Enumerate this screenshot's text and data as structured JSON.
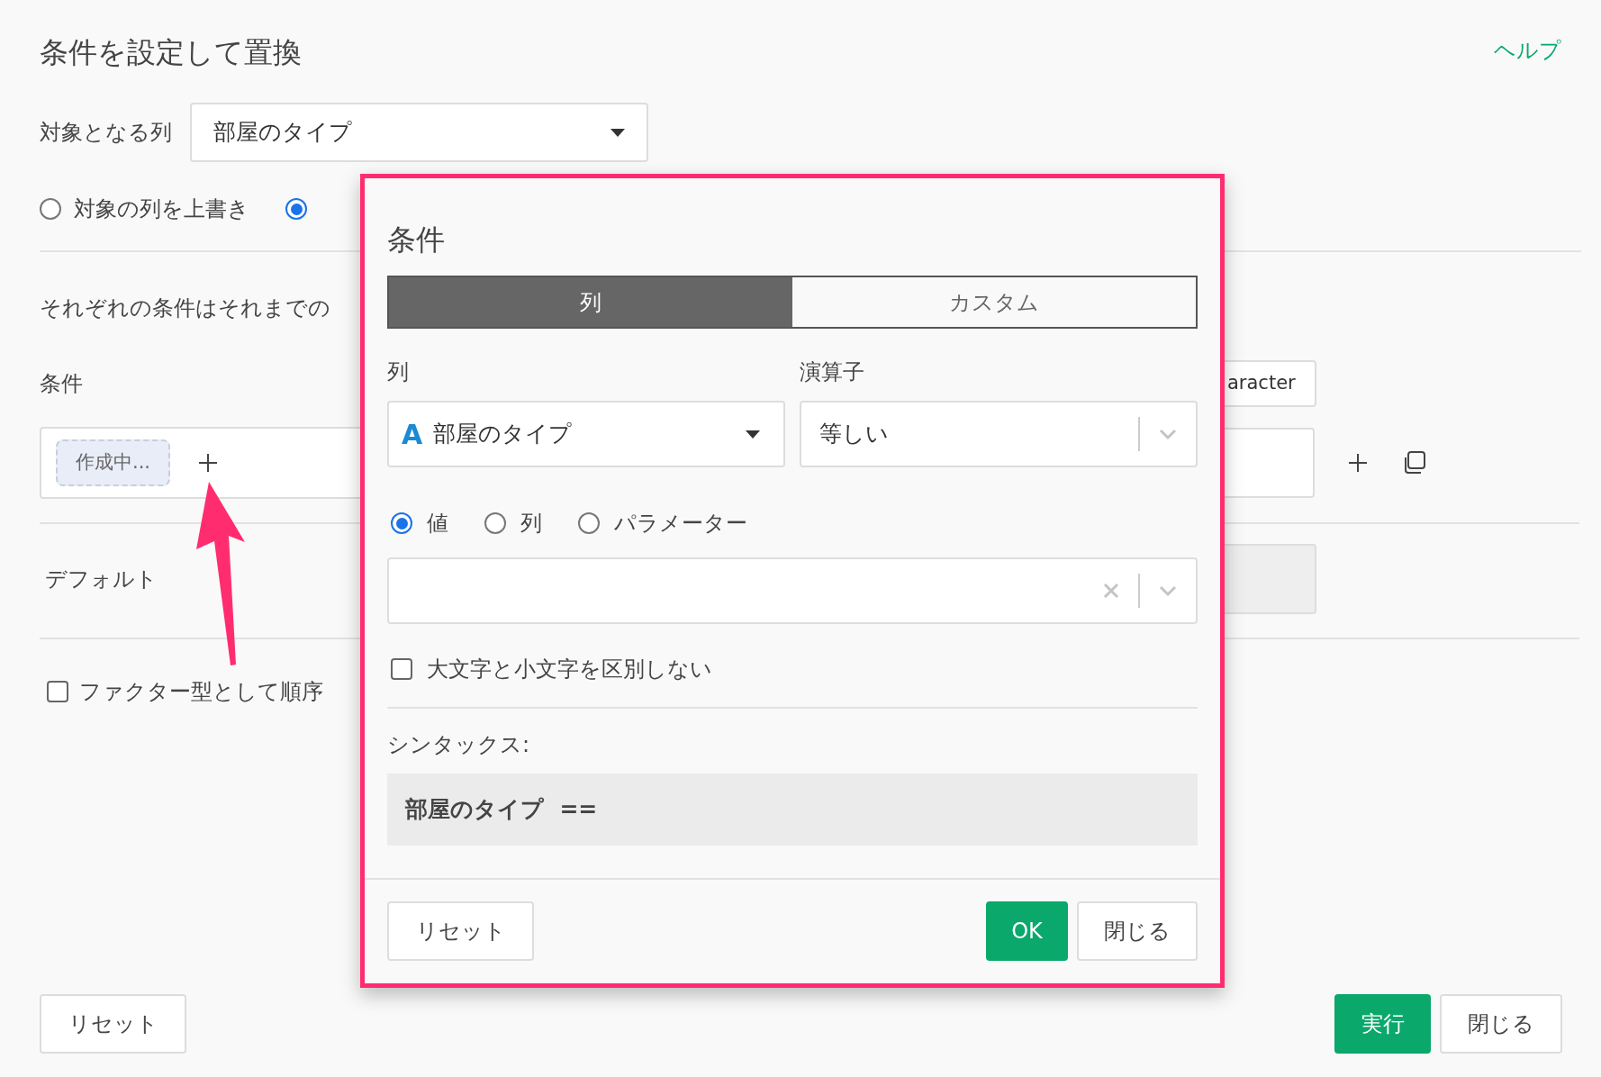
{
  "title": "条件を設定して置換",
  "help_link": "ヘルプ",
  "target_column": {
    "label": "対象となる列",
    "value": "部屋のタイプ"
  },
  "output_options": [
    {
      "label": "対象の列を上書き",
      "selected": false
    },
    {
      "selected": true
    }
  ],
  "description": "それぞれの条件はそれまでの",
  "conditions": {
    "label": "条件",
    "chip": "作成中...",
    "type_select": "aracter"
  },
  "default": {
    "label": "デフォルト"
  },
  "factor_checkbox": {
    "label": "ファクター型として順序",
    "checked": false
  },
  "footer": {
    "reset": "リセット",
    "run": "実行",
    "close": "閉じる"
  },
  "dialog": {
    "title": "条件",
    "tabs": [
      {
        "label": "列",
        "selected": true
      },
      {
        "label": "カスタム",
        "selected": false
      }
    ],
    "column_label": "列",
    "column_type_icon": "A",
    "column_value": "部屋のタイプ",
    "operator_label": "演算子",
    "operator_value": "等しい",
    "value_types": [
      {
        "label": "値",
        "selected": true
      },
      {
        "label": "列",
        "selected": false
      },
      {
        "label": "パラメーター",
        "selected": false
      }
    ],
    "case_insensitive": {
      "label": "大文字と小文字を区別しない",
      "checked": false
    },
    "syntax_label": "シンタックス:",
    "syntax": "部屋のタイプ  ==",
    "buttons": {
      "reset": "リセット",
      "ok": "OK",
      "close": "閉じる"
    }
  }
}
